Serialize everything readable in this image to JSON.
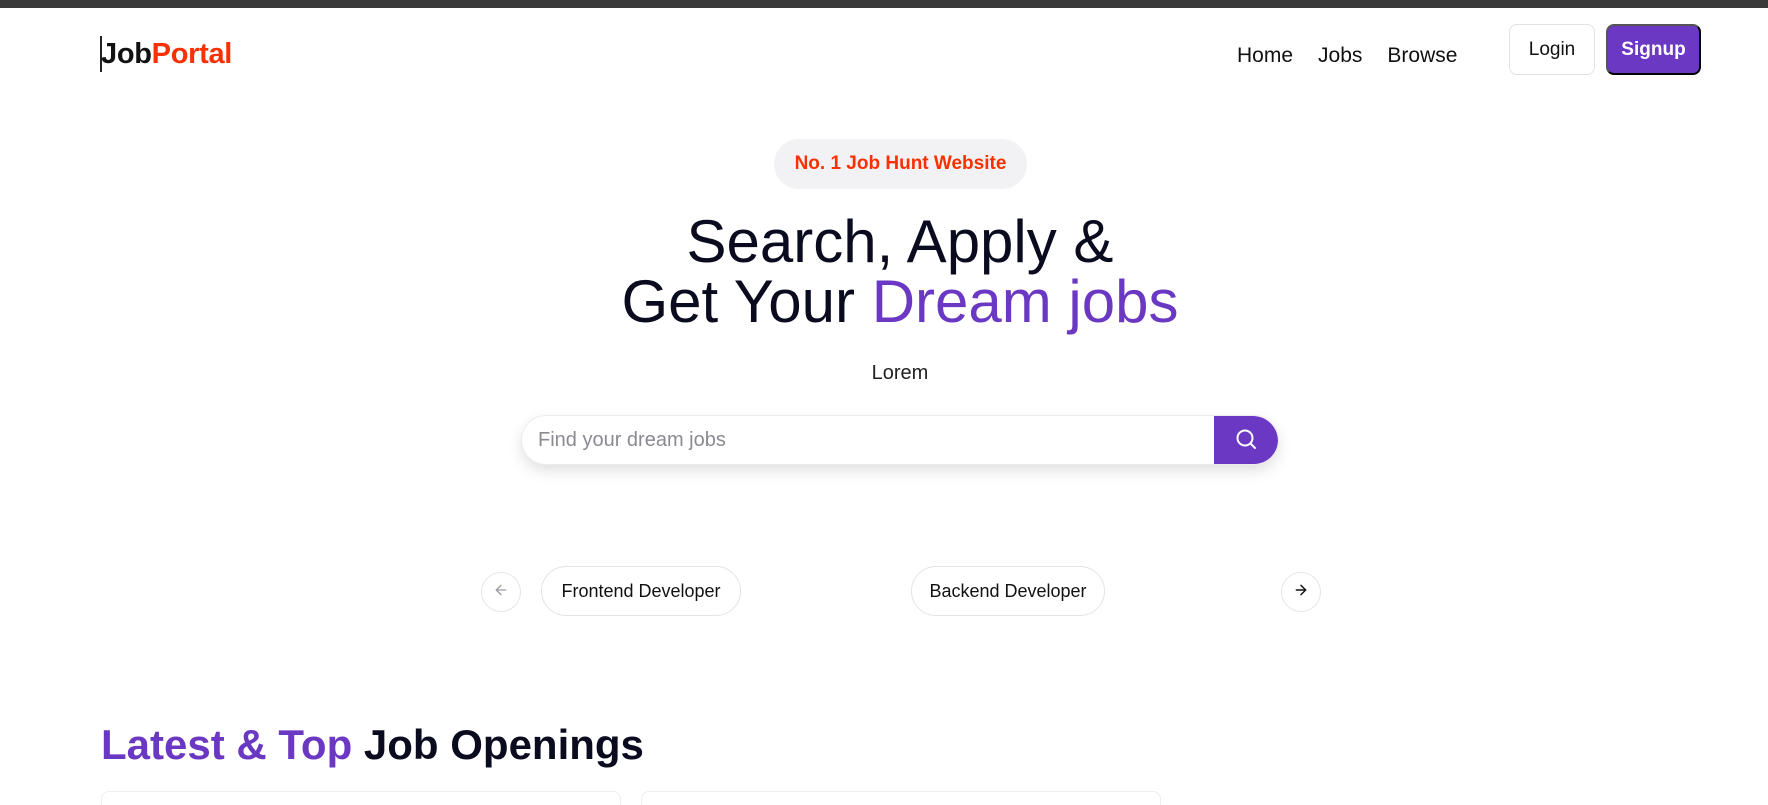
{
  "nav": {
    "logo_part1": "Job",
    "logo_part2": "Portal",
    "links": [
      "Home",
      "Jobs",
      "Browse"
    ],
    "login_label": "Login",
    "signup_label": "Signup"
  },
  "hero": {
    "badge": "No. 1 Job Hunt Website",
    "title_line1": "Search, Apply &",
    "title_line2_prefix": "Get Your ",
    "title_line2_accent": "Dream jobs",
    "subtitle": "Lorem",
    "search_placeholder": "Find your dream jobs",
    "search_value": ""
  },
  "categories": {
    "items": [
      "Frontend Developer",
      "Backend Developer"
    ],
    "prev_icon": "arrow-left-icon",
    "next_icon": "arrow-right-icon"
  },
  "latest": {
    "title_accent": "Latest & Top",
    "title_rest": " Job Openings"
  },
  "colors": {
    "accent": "#6a38c2",
    "brand_red": "#f83002",
    "text_dark": "#0b0b1f"
  }
}
